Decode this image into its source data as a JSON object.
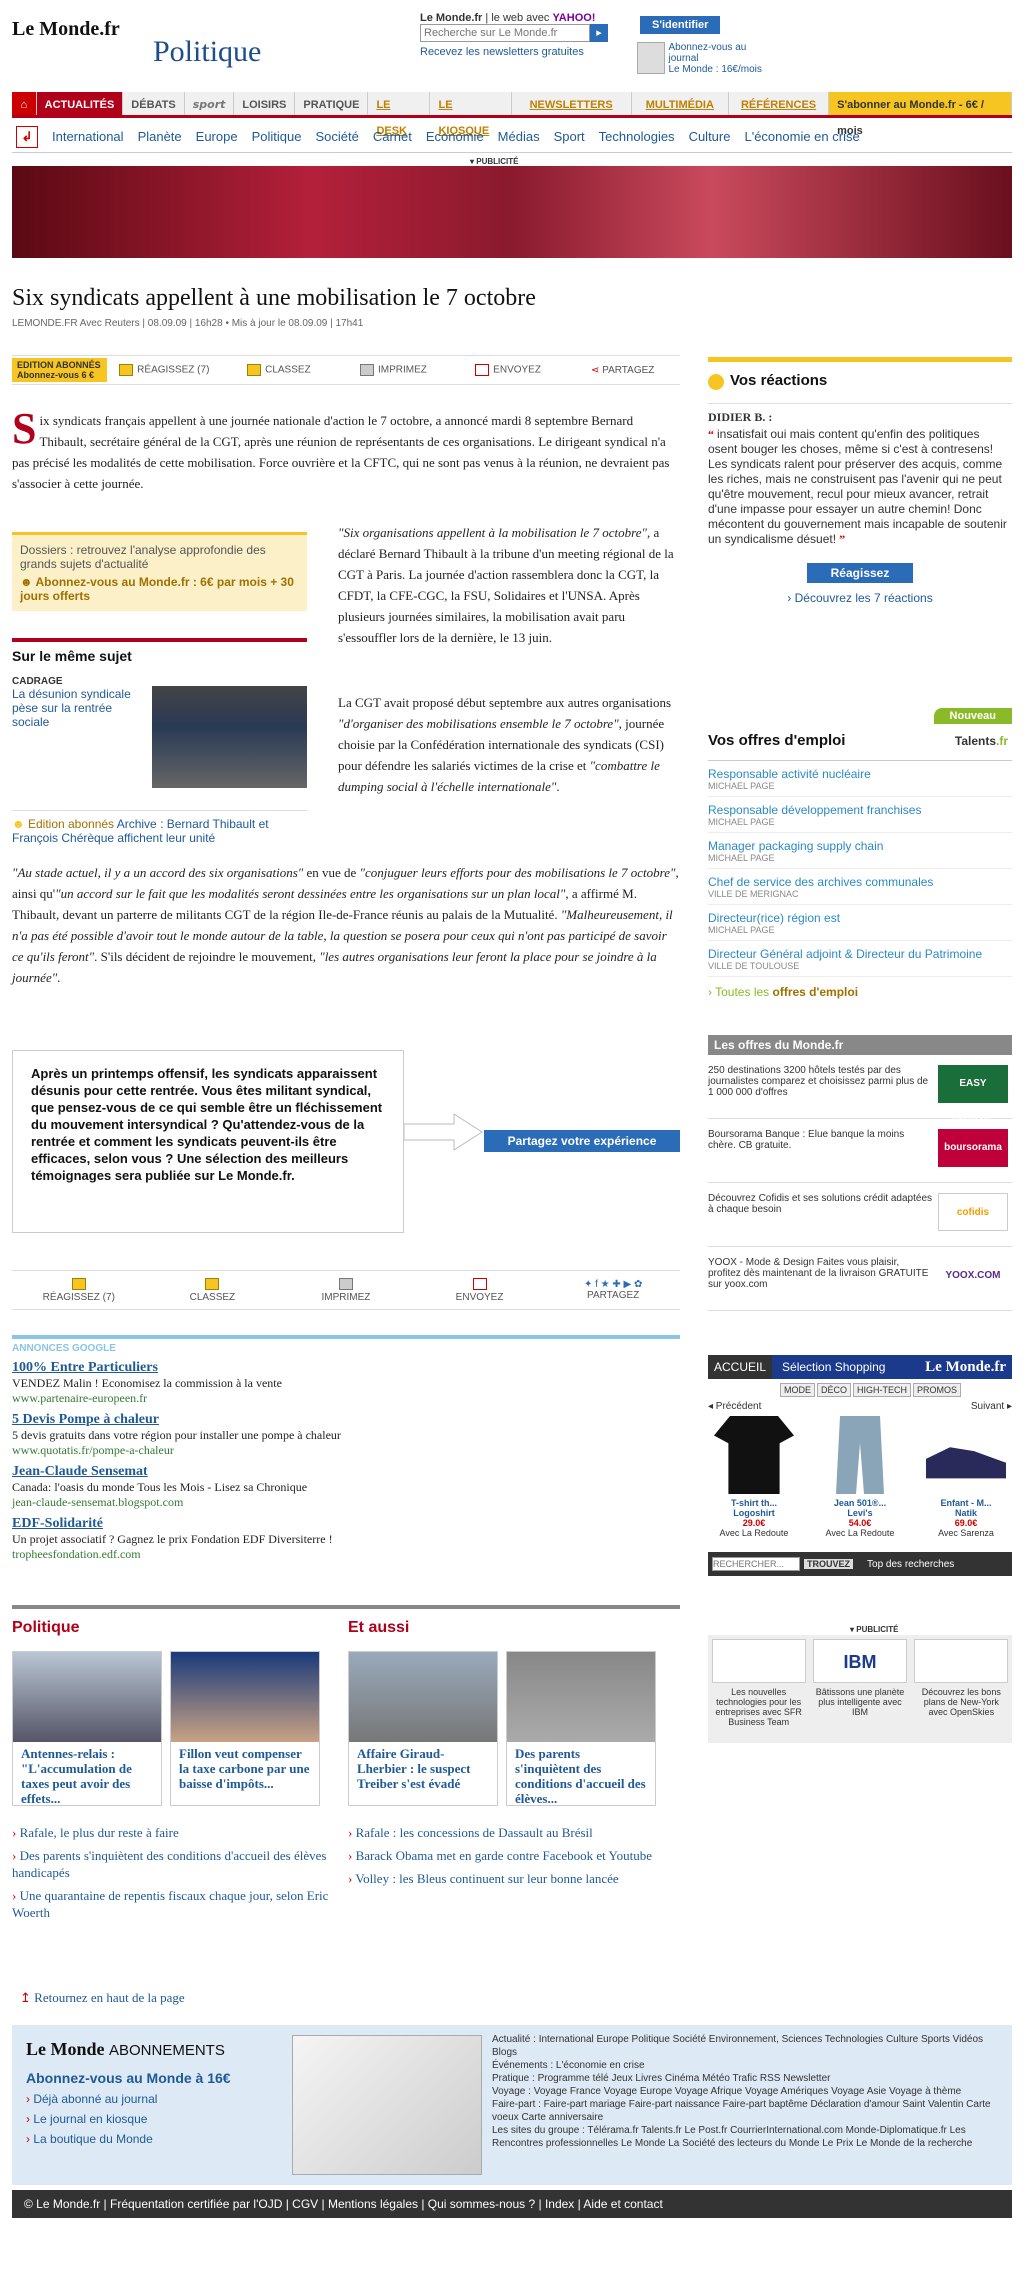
{
  "header": {
    "logo": "Le Monde.fr",
    "section": "Politique",
    "search_label_a": "Le Monde.fr",
    "search_label_b": "le web avec",
    "search_label_yahoo": "YAHOO!",
    "search_placeholder": "Recherche sur Le Monde.fr",
    "newsletters": "Recevez les newsletters gratuites",
    "login": "S'identifier",
    "abo_a": "Abonnez-vous au journal",
    "abo_b": "Le Monde : 16€/mois"
  },
  "nav1": [
    "ACTUALITÉS",
    "DÉBATS",
    "sport",
    "LOISIRS",
    "PRATIQUE",
    "LE DESK",
    "LE KIOSQUE",
    "NEWSLETTERS",
    "MULTIMÉDIA",
    "RÉFÉRENCES"
  ],
  "nav1_sub": "S'abonner au Monde.fr - 6€ / mois",
  "nav2": [
    "International",
    "Planète",
    "Europe",
    "Politique",
    "Société",
    "Carnet",
    "Economie",
    "Médias",
    "Sport",
    "Technologies",
    "Culture",
    "L'économie en crise"
  ],
  "publicite": "PUBLICITÉ",
  "article": {
    "title": "Six syndicats appellent à une mobilisation le 7 octobre",
    "byline": "LEMONDE.FR Avec Reuters | 08.09.09 | 16h28  •  Mis à jour le 08.09.09 | 17h41",
    "ed_a": "EDITION ABONNÉS",
    "ed_b": "Abonnez-vous 6 €",
    "tools": [
      "RÉAGISSEZ (7)",
      "CLASSEZ",
      "IMPRIMEZ",
      "ENVOYEZ",
      "PARTAGEZ"
    ],
    "drop": "S",
    "lead": "ix syndicats français appellent à une journée nationale d'action le 7 octobre, a annoncé mardi 8 septembre Bernard Thibault, secrétaire général de la CGT, après une réunion de représentants de ces organisations. Le dirigeant syndical n'a pas précisé les modalités de cette mobilisation. Force ouvrière et la CFTC, qui ne sont pas venus à la réunion, ne devraient pas s'associer à cette journée.",
    "p2_q": "\"Six organisations appellent à la mobilisation le 7 octobre\"",
    "p2": ", a déclaré Bernard Thibault à la tribune d'un meeting régional de la CGT à Paris. La journée d'action rassemblera donc la CGT, la CFDT, la CFE-CGC, la FSU, Solidaires et l'UNSA. Après plusieurs journées similaires, la mobilisation avait paru s'essouffler lors de la dernière, le 13 juin.",
    "p3_a": "La CGT avait proposé début septembre aux autres organisations ",
    "p3_q1": "\"d'organiser des mobilisations ensemble le 7 octobre\"",
    "p3_b": ", journée choisie par la Confédération internationale des syndicats (CSI) pour défendre les salariés victimes de la crise et ",
    "p3_q2": "\"combattre le dumping social à l'échelle internationale\"",
    "p3_c": ".",
    "p4_q1": "\"Au stade actuel, il y a un accord des six organisations\"",
    "p4_a": " en vue de ",
    "p4_q2": "\"conjuguer leurs efforts pour des mobilisations le 7 octobre\"",
    "p4_b": ", ainsi qu'",
    "p4_q3": "\"un accord sur le fait que les modalités seront dessinées entre les organisations sur un plan local\"",
    "p4_c": ", a affirmé M. Thibault, devant un parterre de militants CGT de la région Ile-de-France réunis au palais de la Mutualité. ",
    "p4_q4": "\"Malheureusement, il n'a pas été possible d'avoir tout le monde autour de la table, la question se posera pour ceux qui n'ont pas participé de savoir ce qu'ils feront\"",
    "p4_d": ". S'ils décident de rejoindre le mouvement, ",
    "p4_q5": "\"les autres organisations leur feront la place pour se joindre à la journée\"",
    "p4_e": ".",
    "callout": "Après un printemps offensif, les syndicats apparaissent désunis pour cette rentrée. Vous êtes militant syndical, que pensez-vous de ce qui semble être un fléchissement du mouvement intersyndical ? Qu'attendez-vous de la rentrée et comment les syndicats peuvent-ils être efficaces, selon vous ? Une sélection des meilleurs témoignages sera publiée sur Le Monde.fr.",
    "share": "Partagez votre expérience"
  },
  "dossier": {
    "text": "Dossiers : retrouvez l'analyse approfondie des grands sujets d'actualité",
    "abo": "Abonnez-vous au Monde.fr : 6€ par mois + 30 jours offerts"
  },
  "same": {
    "title": "Sur le même sujet",
    "kicker": "CADRAGE",
    "link": "La désunion syndicale pèse sur la rentrée sociale",
    "arch_ed": "Edition abonnés",
    "arch": " Archive : Bernard Thibault et François Chérèque affichent leur unité"
  },
  "ads": {
    "hdr": "ANNONCES GOOGLE",
    "items": [
      {
        "a": "100% Entre Particuliers",
        "d": "VENDEZ Malin ! Economisez la commission à la vente",
        "u": "www.partenaire-europeen.fr"
      },
      {
        "a": "5 Devis Pompe à chaleur",
        "d": "5 devis gratuits dans votre région pour installer une pompe à chaleur",
        "u": "www.quotatis.fr/pompe-a-chaleur"
      },
      {
        "a": "Jean-Claude Sensemat",
        "d": "Canada: l'oasis du monde Tous les Mois - Lisez sa Chronique",
        "u": "jean-claude-sensemat.blogspot.com"
      },
      {
        "a": "EDF-Solidarité",
        "d": "Un projet associatif ? Gagnez le prix Fondation EDF Diversiterre !",
        "u": "tropheesfondation.edf.com"
      }
    ]
  },
  "bottom": {
    "pol_title": "Politique",
    "aussi_title": "Et aussi",
    "cards": [
      "Antennes-relais : \"L'accumulation de taxes peut avoir des effets...",
      "Fillon veut compenser la taxe carbone par une baisse d'impôts...",
      "Affaire Giraud-Lherbier : le suspect Treiber s'est évadé",
      "Des parents s'inquiètent des conditions d'accueil des élèves..."
    ],
    "pol_list": [
      "Rafale, le plus dur reste à faire",
      "Des parents s'inquiètent des conditions d'accueil des élèves handicapés",
      "Une quarantaine de repentis fiscaux chaque jour, selon Eric Woerth"
    ],
    "aussi_list": [
      "Rafale : les concessions de Dassault au Brésil",
      "Barack Obama met en garde contre Facebook et Youtube",
      "Volley : les Bleus continuent sur leur bonne lancée"
    ],
    "backtop": "Retournez en haut de la page"
  },
  "reactions": {
    "title": "Vos réactions",
    "who": "DIDIER B. :",
    "text": "insatisfait oui mais content qu'enfin des politiques osent bouger les choses, même si c'est à contresens! Les syndicats ralent pour préserver des acquis, comme les riches, mais ne construisent pas l'avenir qui ne peut qu'être mouvement, recul pour mieux avancer, retrait d'une impasse pour essayer un autre chemin! Donc mécontent du gouvernement mais incapable de soutenir un syndicalisme désuet!",
    "btn": "Réagissez",
    "all": "Découvrez les 7 réactions"
  },
  "jobs": {
    "nouveau": "Nouveau",
    "title": "Vos offres d'emploi",
    "talents": "Talents",
    "talents_fr": ".fr",
    "items": [
      {
        "a": "Responsable activité nucléaire",
        "c": "MICHAEL PAGE"
      },
      {
        "a": "Responsable développement franchises",
        "c": "MICHAEL PAGE"
      },
      {
        "a": "Manager packaging supply chain",
        "c": "MICHAEL PAGE"
      },
      {
        "a": "Chef de service des archives communales",
        "c": "VILLE DE MERIGNAC"
      },
      {
        "a": "Directeur(rice) région est",
        "c": "MICHAEL PAGE"
      },
      {
        "a": "Directeur Général adjoint & Directeur du Patrimoine",
        "c": "VILLE DE TOULOUSE"
      }
    ],
    "all_a": "Toutes les ",
    "all_b": "offres d'emploi"
  },
  "offres": {
    "title": "Les offres du Monde.fr",
    "items": [
      {
        "t": "250 destinations 3200 hôtels testés par des journalistes comparez et choisissez parmi plus de 1 000 000 d'offres",
        "lg": "EASY VOYAGE",
        "c": "#1a6e3a"
      },
      {
        "t": "Boursorama Banque : Elue banque la moins chère. CB gratuite.",
        "lg": "boursorama",
        "c": "#c0003a"
      },
      {
        "t": "Découvrez Cofidis et ses solutions crédit adaptées à chaque besoin",
        "lg": "cofidis",
        "c": "#f39c00"
      },
      {
        "t": "YOOX - Mode & Design Faites vous plaisir, profitez dès maintenant de la livraison GRATUITE sur yoox.com",
        "lg": "YOOX.COM",
        "c": "#5a2a8a"
      }
    ]
  },
  "shop": {
    "accueil": "ACCUEIL",
    "sel": "Sélection Shopping",
    "lm": "Le Monde.fr",
    "sub": [
      "MODE",
      "DÉCO",
      "HIGH-TECH",
      "PROMOS"
    ],
    "prev": "◂ Précédent",
    "next": "Suivant ▸",
    "prods": [
      {
        "n": "T-shirt th...",
        "b": "Logoshirt",
        "p": "29.0€",
        "s": "Avec La Redoute",
        "c": "#111"
      },
      {
        "n": "Jean 501®...",
        "b": "Levi's",
        "p": "54.0€",
        "s": "Avec La Redoute",
        "c": "#8aa4b8"
      },
      {
        "n": "Enfant - M...",
        "b": "Natik",
        "p": "69.0€",
        "s": "Avec Sarenza",
        "c": "#2a2a5a"
      }
    ],
    "rs_placeholder": "RECHERCHER...",
    "rs_btn": "TROUVEZ",
    "top": "Top des recherches"
  },
  "ads3": [
    {
      "t": "Les nouvelles technologies pour les entreprises avec SFR Business Team",
      "lg": ""
    },
    {
      "t": "Bâtissons une planète plus intelligente avec IBM",
      "lg": "IBM"
    },
    {
      "t": "Découvrez les bons plans de New-York avec OpenSkies",
      "lg": ""
    }
  ],
  "footer": {
    "logo": "Le Monde",
    "abo": "ABONNEMENTS",
    "offer": "Abonnez-vous au Monde à 16€",
    "links": [
      "Déjà abonné au journal",
      "Le journal en kiosque",
      "La boutique du Monde"
    ],
    "rubriques": "Actualité : International  Europe  Politique  Société  Environnement, Sciences  Technologies  Culture  Sports  Vidéos  Blogs",
    "evenements": "Événements : L'économie en crise",
    "pratique": "Pratique : Programme télé  Jeux  Livres  Cinéma  Météo  Trafic  RSS  Newsletter",
    "voyage": "Voyage : Voyage France  Voyage Europe  Voyage Afrique  Voyage Amériques  Voyage Asie  Voyage à thème",
    "fairepart": "Faire-part : Faire-part mariage  Faire-part naissance  Faire-part baptême  Déclaration d'amour  Saint Valentin  Carte voeux  Carte anniversaire",
    "groupe": "Les sites du groupe : Télérama.fr  Talents.fr  Le Post.fr  CourrierInternational.com  Monde-Diplomatique.fr  Les Rencontres professionnelles Le Monde  La Société des lecteurs du Monde  Le Prix Le Monde de la recherche",
    "bar": "© Le Monde.fr | Fréquentation certifiée par l'OJD | CGV | Mentions légales | Qui sommes-nous ? | Index | Aide et contact"
  }
}
